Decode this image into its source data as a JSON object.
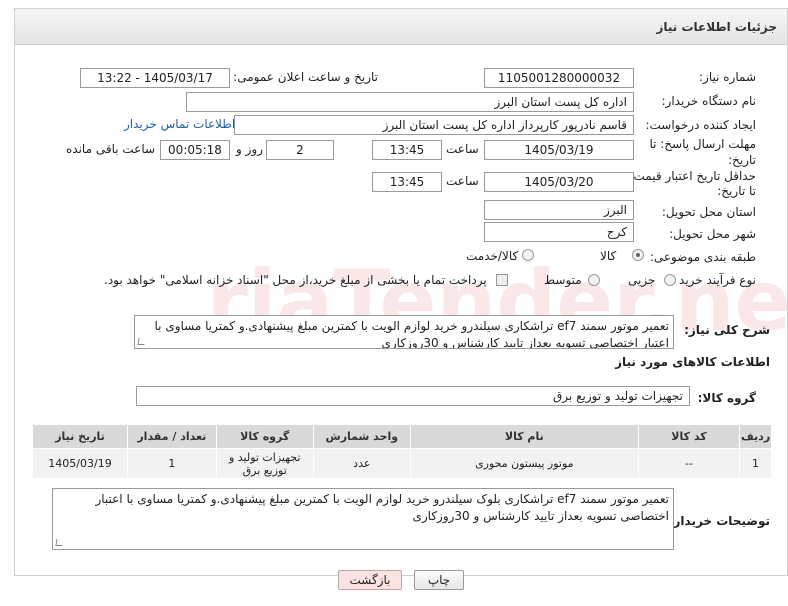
{
  "header": {
    "title": "جزئیات اطلاعات نیاز"
  },
  "fields": {
    "need_number_label": "شماره نیاز:",
    "need_number": "1105001280000032",
    "announce_label": "تاریخ و ساعت اعلان عمومی:",
    "announce_value": "1405/03/17 - 13:22",
    "buyer_org_label": "نام دستگاه خریدار:",
    "buyer_org": "اداره کل پست استان البرز",
    "creator_label": "ایجاد کننده درخواست:",
    "creator": "قاسم نادرپور کارپرداز اداره کل پست استان البرز",
    "contact_link": "اطلاعات تماس خریدار",
    "deadline_label_1": "مهلت ارسال پاسخ: تا",
    "deadline_label_2": "تاریخ:",
    "deadline_date": "1405/03/19",
    "deadline_time_label": "ساعت",
    "deadline_time": "13:45",
    "days_value": "2",
    "days_label": "روز و",
    "remaining_time": "00:05:18",
    "remaining_label": "ساعت باقی مانده",
    "validity_label_1": "حداقل تاریخ اعتبار قیمت:",
    "validity_label_2": "تا تاریخ:",
    "validity_date": "1405/03/20",
    "validity_time_label": "ساعت",
    "validity_time": "13:45",
    "province_label": "استان محل تحویل:",
    "province": "البرز",
    "city_label": "شهر محل تحویل:",
    "city": "کرج",
    "category_label": "طبقه بندی موضوعی:",
    "category_options": [
      "کالا",
      "کالا/خدمت"
    ],
    "process_label": "نوع فرآیند خرید :",
    "process_options": [
      "جزیی",
      "متوسط"
    ],
    "payment_note": "پرداخت تمام یا بخشی از مبلغ خرید،از محل \"اسناد خزانه اسلامی\" خواهد بود."
  },
  "summary": {
    "label": "شرح کلی نیاز:",
    "text": "تعمیر موتور سمند ef7 تراشکاری سیلندرو خرید لوازم الویت با کمترین مبلغ پیشنهادی.و کمتریا مساوی با اعتبار اختصاصی تسویه بعداز تایید کارشناس و 30روزکاری"
  },
  "goods": {
    "section_title": "اطلاعات کالاهای مورد نیاز",
    "group_label": "گروه کالا:",
    "group_value": "تجهیزات تولید و توزیع برق",
    "columns": [
      "ردیف",
      "کد کالا",
      "نام کالا",
      "واحد شمارش",
      "گروه کالا",
      "تعداد / مقدار",
      "تاریخ نیاز"
    ],
    "rows": [
      [
        "1",
        "--",
        "موتور پیستون محوری",
        "عدد",
        "تجهیزات تولید و توزیع برق",
        "1",
        "1405/03/19"
      ]
    ]
  },
  "buyer_notes": {
    "label": "توضیحات خریدار:",
    "text": "تعمیر موتور سمند ef7 تراشکاری  بلوک سیلندرو خرید لوازم الویت با کمترین مبلغ پیشنهادی.و کمتریا مساوی با اعتبار اختصاصی تسویه بعداز تایید کارشناس و 30روزکاری"
  },
  "buttons": {
    "print": "چاپ",
    "back": "بازگشت"
  },
  "watermark_text": "AriaTender.neT"
}
